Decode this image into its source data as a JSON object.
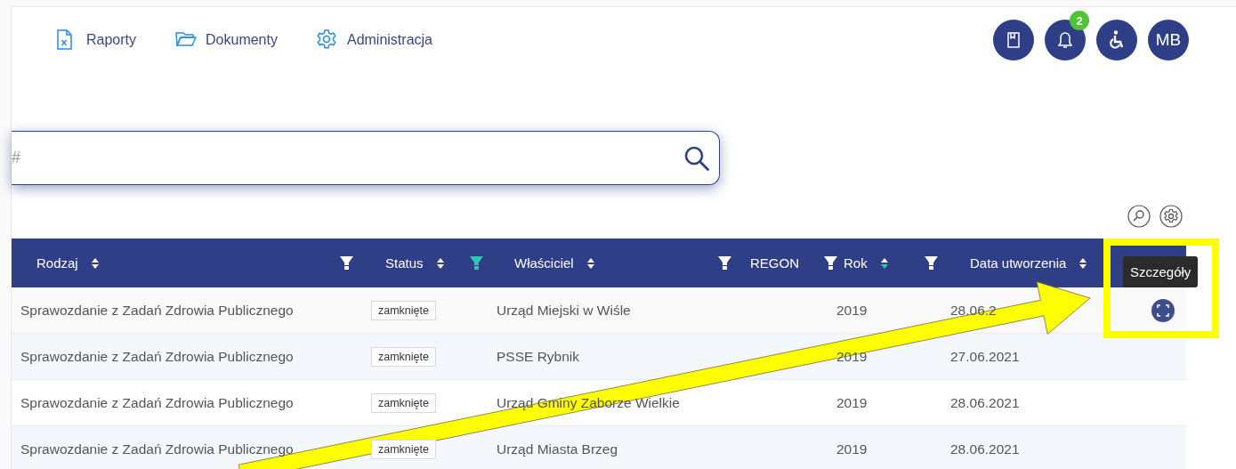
{
  "nav": [
    {
      "label": "Raporty"
    },
    {
      "label": "Dokumenty"
    },
    {
      "label": "Administracja"
    }
  ],
  "header_buttons": [
    {
      "kind": "book"
    },
    {
      "kind": "bell",
      "badge": "2"
    },
    {
      "kind": "accessibility"
    },
    {
      "kind": "avatar",
      "initials": "MB"
    }
  ],
  "search": {
    "placeholder": "#"
  },
  "table": {
    "columns": [
      {
        "label": "Rodzaj",
        "sortable": true,
        "sorted_descending": false,
        "filter": true,
        "filter_active": false
      },
      {
        "label": "Status",
        "sortable": true,
        "sorted_descending": false,
        "filter": true,
        "filter_active": true
      },
      {
        "label": "Właściciel",
        "sortable": true,
        "sorted_descending": false,
        "filter": true,
        "filter_active": false
      },
      {
        "label": "REGON",
        "sortable": false,
        "filter": true,
        "filter_active": false
      },
      {
        "label": "Rok",
        "sortable": true,
        "sorted_descending": true,
        "filter": true,
        "filter_active": false
      },
      {
        "label": "Data utworzenia",
        "sortable": true,
        "sorted_descending": false,
        "filter": false
      }
    ],
    "rows": [
      {
        "type": "Sprawozdanie z Zadań Zdrowia Publicznego",
        "status": "zamknięte",
        "owner": "Urząd Miejski w Wiśle",
        "year": "2019",
        "created": "28.06.2",
        "details_button": true
      },
      {
        "type": "Sprawozdanie z Zadań Zdrowia Publicznego",
        "status": "zamknięte",
        "owner": "PSSE Rybnik",
        "year": "2019",
        "created": "27.06.2021",
        "details_button": false
      },
      {
        "type": "Sprawozdanie z Zadań Zdrowia Publicznego",
        "status": "zamknięte",
        "owner": "Urząd Gminy Zaborze Wielkie",
        "year": "2019",
        "created": "28.06.2021",
        "details_button": false
      },
      {
        "type": "Sprawozdanie z Zadań Zdrowia Publicznego",
        "status": "zamknięte",
        "owner": "Urząd Miasta Brzeg",
        "year": "2019",
        "created": "28.06.2021",
        "details_button": false
      }
    ]
  },
  "tooltip": {
    "text": "Szczegóły"
  },
  "annotations": {
    "highlight_frame": true,
    "arrow": true
  }
}
